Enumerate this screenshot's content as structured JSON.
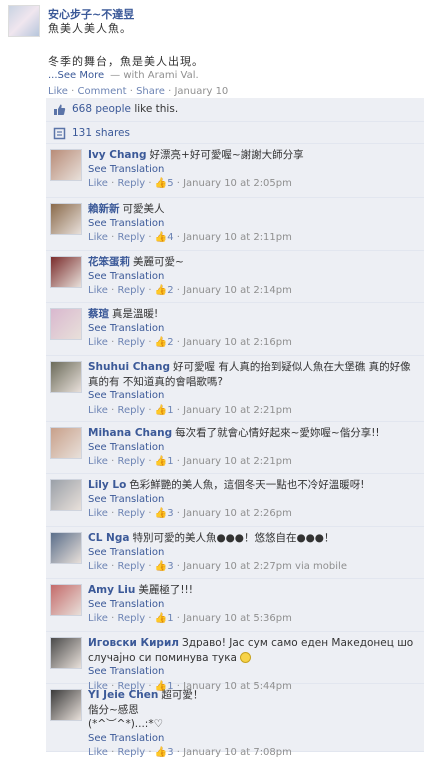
{
  "post": {
    "author": "安心步子~不達昱",
    "subtitle": "魚美人美人魚。",
    "message": "冬季的舞台，魚是美人出現。",
    "see_more": "...See More",
    "with_text": "— with Arami Val.",
    "actions": {
      "like": "Like",
      "comment": "Comment",
      "share": "Share",
      "date": "January 10",
      "sep": "·"
    }
  },
  "likes": {
    "count_text": "668 people",
    "rest": " like this."
  },
  "shares": {
    "text": "131 shares"
  },
  "ui": {
    "like": "Like",
    "reply": "Reply",
    "see_translation": "See Translation",
    "sep": " · ",
    "thumb": "👍"
  },
  "comments": [
    {
      "name": "Ivy Chang",
      "lines": [
        "好漂亮+好可愛喔~謝謝大師分享"
      ],
      "likes": "5",
      "time": "January 10 at 2:05pm",
      "avatar_color": "#b88c78"
    },
    {
      "name": "賴新新",
      "lines": [
        "可愛美人"
      ],
      "likes": "4",
      "time": "January 10 at 2:11pm",
      "avatar_color": "#8a6a4b"
    },
    {
      "name": "花笨蛋莉",
      "lines": [
        "美麗可愛~"
      ],
      "likes": "2",
      "time": "January 10 at 2:14pm",
      "avatar_color": "#7a2c2c"
    },
    {
      "name": "蔡瑄",
      "lines": [
        "真是溫暖!"
      ],
      "likes": "2",
      "time": "January 10 at 2:16pm",
      "avatar_color": "#d9b8cf"
    },
    {
      "name": "Shuhui Chang",
      "lines": [
        "好可愛喔 有人真的抬到疑似人魚在大堡礁 真的好像",
        "真的有 不知道真的會唱歌嗎?"
      ],
      "likes": "1",
      "time": "January 10 at 2:21pm",
      "avatar_color": "#6b6b5a"
    },
    {
      "name": "Mihana Chang",
      "lines": [
        "每次看了就會心情好起來~愛妳喔~偕分享!!"
      ],
      "likes": "1",
      "time": "January 10 at 2:21pm",
      "avatar_color": "#c8a08a"
    },
    {
      "name": "Lily Lo",
      "lines": [
        "色彩鮮艷的美人魚，這個冬天一點也不冷好溫暖呀!"
      ],
      "likes": "3",
      "time": "January 10 at 2:26pm",
      "avatar_color": "#9aa0a8"
    },
    {
      "name": "CL Nga",
      "lines": [
        "特別可愛的美人魚●●●！悠悠自在●●●！"
      ],
      "likes": "3",
      "time": "January 10 at 2:27pm via mobile",
      "avatar_color": "#5a6e8a"
    },
    {
      "name": "Amy Liu",
      "lines": [
        "美麗極了!!!"
      ],
      "likes": "1",
      "time": "January 10 at 5:36pm",
      "avatar_color": "#c46a6a"
    },
    {
      "name": "Иговски Кирил",
      "lines": [
        "Здраво! Јас сум само еден Македонец шо",
        "случајно си поминува тука"
      ],
      "emoji": true,
      "likes": "1",
      "time": "January 10 at 5:44pm",
      "avatar_color": "#4a4a4a"
    },
    {
      "name": "YI Jeie Chen",
      "lines": [
        "超可愛！",
        "偕分~感恩",
        "(*^︶^*)...:*♡"
      ],
      "likes": "3",
      "time": "January 10 at 7:08pm",
      "avatar_color": "#3a3a3a"
    }
  ]
}
